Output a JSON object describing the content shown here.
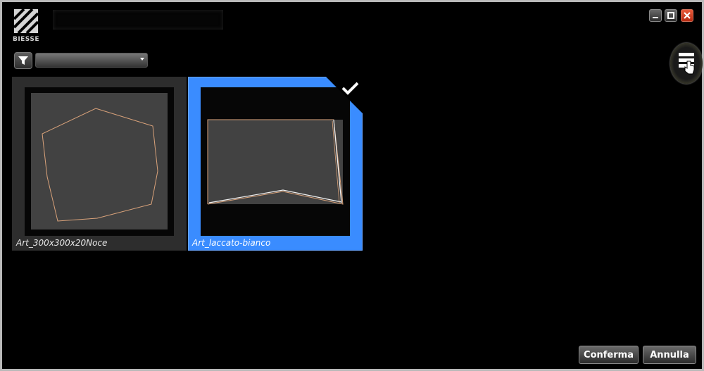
{
  "brand": {
    "logo_text": "BIESSE"
  },
  "filter": {
    "selected_value": ""
  },
  "items": [
    {
      "label": "Art_300x300x20Noce",
      "selected": false
    },
    {
      "label": "Art_laccato-bianco",
      "selected": true
    }
  ],
  "actions": {
    "confirm_label": "Conferma",
    "cancel_label": "Annulla"
  },
  "colors": {
    "accent": "#3a8cff",
    "card": "#2d2d2d",
    "panel": "#424242",
    "outline": "#d9a27a"
  },
  "icons": {
    "filter": "filter-icon",
    "view_toggle": "list-view-icon",
    "check": "check-icon"
  }
}
